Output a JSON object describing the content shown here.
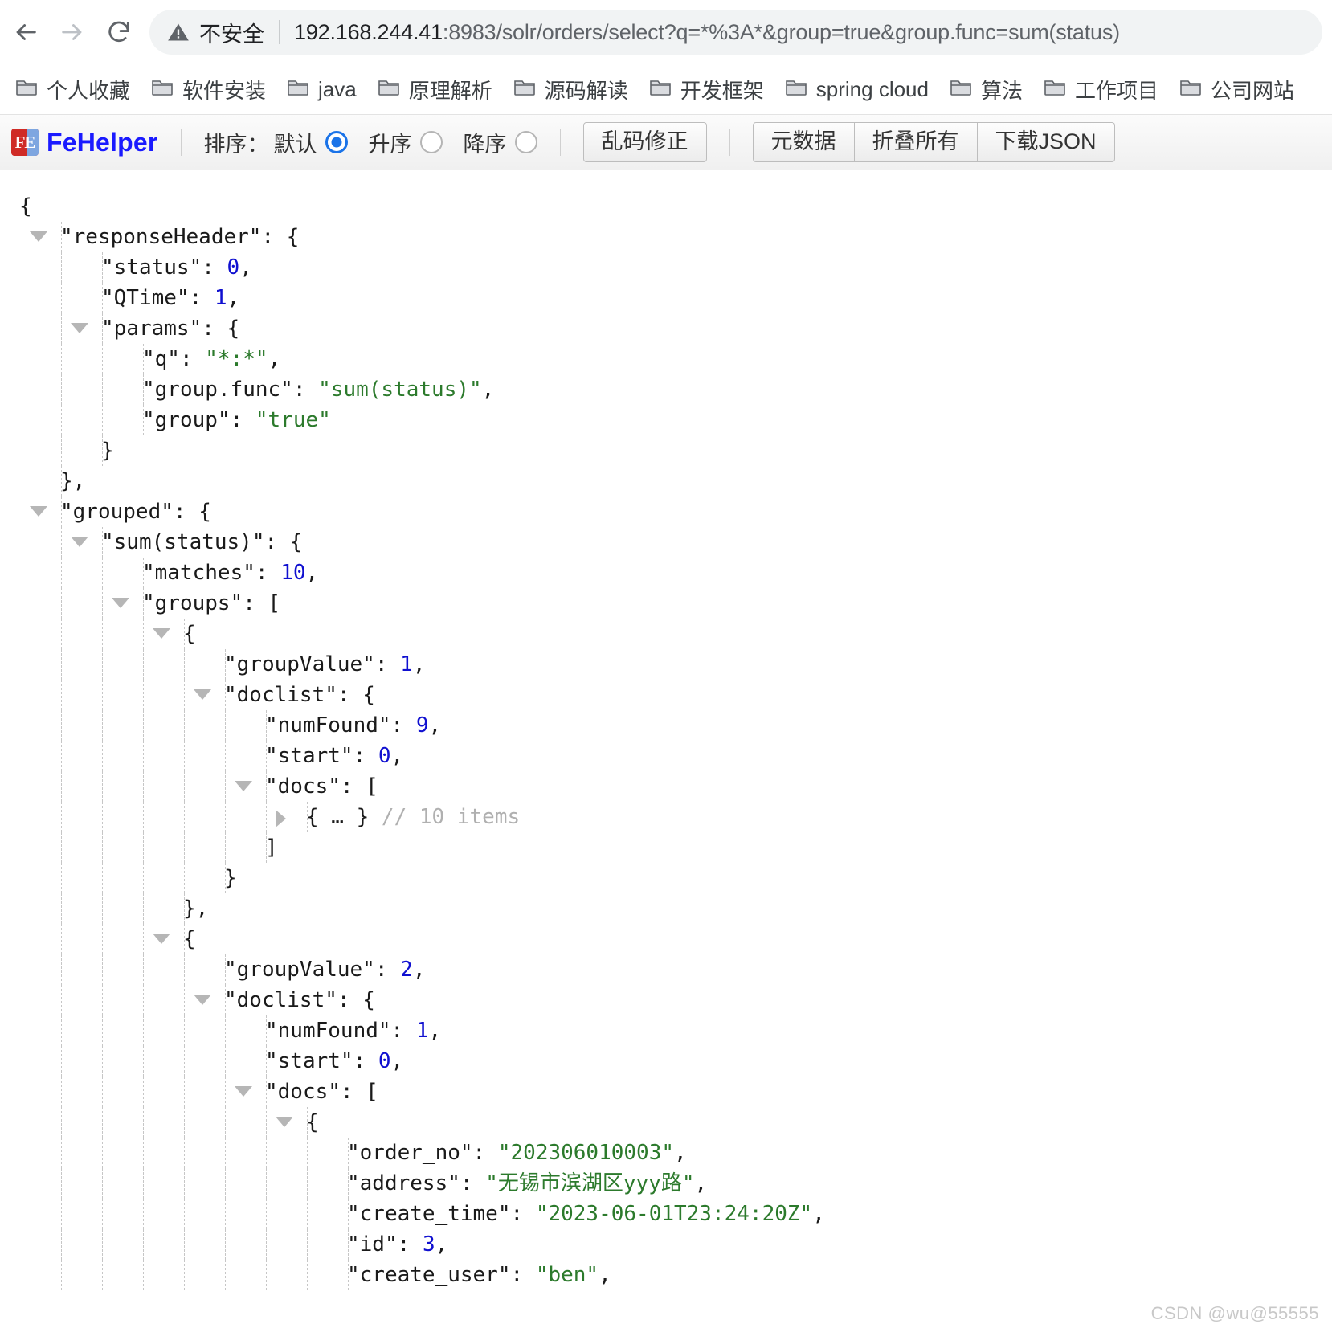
{
  "browser": {
    "back_icon": "arrow-left-icon",
    "forward_icon": "arrow-right-icon",
    "reload_icon": "reload-icon",
    "security_icon": "warning-triangle-icon",
    "security_label": "不安全",
    "url_host": "192.168.244.41",
    "url_rest": ":8983/solr/orders/select?q=*%3A*&group=true&group.func=sum(status)",
    "url_full": "192.168.244.41:8983/solr/orders/select?q=*%3A*&group=true&group.func=sum(status)"
  },
  "bookmarks": {
    "folder_icon": "folder-icon",
    "items": [
      {
        "label": "个人收藏"
      },
      {
        "label": "软件安装"
      },
      {
        "label": "java"
      },
      {
        "label": "原理解析"
      },
      {
        "label": "源码解读"
      },
      {
        "label": "开发框架"
      },
      {
        "label": "spring cloud"
      },
      {
        "label": "算法"
      },
      {
        "label": "工作项目"
      },
      {
        "label": "公司网站"
      }
    ]
  },
  "fehelper": {
    "logo_icon": "fehelper-logo-icon",
    "logo_text": "FE",
    "brand": "FeHelper",
    "sort_label": "排序：",
    "sort_options": [
      {
        "label": "默认",
        "selected": true
      },
      {
        "label": "升序",
        "selected": false
      },
      {
        "label": "降序",
        "selected": false
      }
    ],
    "fix_encoding_label": "乱码修正",
    "metadata_label": "元数据",
    "collapse_all_label": "折叠所有",
    "download_json_label": "下载JSON",
    "accent_color": "#1a73e8",
    "brand_color": "#1a1aff"
  },
  "json_viewer": {
    "colors": {
      "key": "#1a1a1a",
      "string": "#2c7a2c",
      "number": "#1010d0",
      "comment": "#b0b0b0"
    },
    "lines": [
      {
        "indent": 0,
        "guides": 0,
        "toggle": "",
        "tokens": [
          {
            "t": "{",
            "c": "p"
          }
        ]
      },
      {
        "indent": 1,
        "guides": 1,
        "toggle": "open",
        "tokens": [
          {
            "t": "\"responseHeader\"",
            "c": "k"
          },
          {
            "t": ": {",
            "c": "p"
          }
        ]
      },
      {
        "indent": 2,
        "guides": 2,
        "toggle": "",
        "tokens": [
          {
            "t": "\"status\"",
            "c": "k"
          },
          {
            "t": ": ",
            "c": "p"
          },
          {
            "t": "0",
            "c": "n"
          },
          {
            "t": ",",
            "c": "p"
          }
        ]
      },
      {
        "indent": 2,
        "guides": 2,
        "toggle": "",
        "tokens": [
          {
            "t": "\"QTime\"",
            "c": "k"
          },
          {
            "t": ": ",
            "c": "p"
          },
          {
            "t": "1",
            "c": "n"
          },
          {
            "t": ",",
            "c": "p"
          }
        ]
      },
      {
        "indent": 2,
        "guides": 2,
        "toggle": "open",
        "tokens": [
          {
            "t": "\"params\"",
            "c": "k"
          },
          {
            "t": ": {",
            "c": "p"
          }
        ]
      },
      {
        "indent": 3,
        "guides": 3,
        "toggle": "",
        "tokens": [
          {
            "t": "\"q\"",
            "c": "k"
          },
          {
            "t": ": ",
            "c": "p"
          },
          {
            "t": "\"*:*\"",
            "c": "s"
          },
          {
            "t": ",",
            "c": "p"
          }
        ]
      },
      {
        "indent": 3,
        "guides": 3,
        "toggle": "",
        "tokens": [
          {
            "t": "\"group.func\"",
            "c": "k"
          },
          {
            "t": ": ",
            "c": "p"
          },
          {
            "t": "\"sum(status)\"",
            "c": "s"
          },
          {
            "t": ",",
            "c": "p"
          }
        ]
      },
      {
        "indent": 3,
        "guides": 3,
        "toggle": "",
        "tokens": [
          {
            "t": "\"group\"",
            "c": "k"
          },
          {
            "t": ": ",
            "c": "p"
          },
          {
            "t": "\"true\"",
            "c": "s"
          }
        ]
      },
      {
        "indent": 2,
        "guides": 2,
        "toggle": "",
        "tokens": [
          {
            "t": "}",
            "c": "p"
          }
        ]
      },
      {
        "indent": 1,
        "guides": 1,
        "toggle": "",
        "tokens": [
          {
            "t": "},",
            "c": "p"
          }
        ]
      },
      {
        "indent": 1,
        "guides": 1,
        "toggle": "open",
        "tokens": [
          {
            "t": "\"grouped\"",
            "c": "k"
          },
          {
            "t": ": {",
            "c": "p"
          }
        ]
      },
      {
        "indent": 2,
        "guides": 2,
        "toggle": "open",
        "tokens": [
          {
            "t": "\"sum(status)\"",
            "c": "k"
          },
          {
            "t": ": {",
            "c": "p"
          }
        ]
      },
      {
        "indent": 3,
        "guides": 3,
        "toggle": "",
        "tokens": [
          {
            "t": "\"matches\"",
            "c": "k"
          },
          {
            "t": ": ",
            "c": "p"
          },
          {
            "t": "10",
            "c": "n"
          },
          {
            "t": ",",
            "c": "p"
          }
        ]
      },
      {
        "indent": 3,
        "guides": 3,
        "toggle": "open",
        "tokens": [
          {
            "t": "\"groups\"",
            "c": "k"
          },
          {
            "t": ": [",
            "c": "p"
          }
        ]
      },
      {
        "indent": 4,
        "guides": 4,
        "toggle": "open",
        "tokens": [
          {
            "t": "{",
            "c": "p"
          }
        ]
      },
      {
        "indent": 5,
        "guides": 5,
        "toggle": "",
        "tokens": [
          {
            "t": "\"groupValue\"",
            "c": "k"
          },
          {
            "t": ": ",
            "c": "p"
          },
          {
            "t": "1",
            "c": "n"
          },
          {
            "t": ",",
            "c": "p"
          }
        ]
      },
      {
        "indent": 5,
        "guides": 5,
        "toggle": "open",
        "tokens": [
          {
            "t": "\"doclist\"",
            "c": "k"
          },
          {
            "t": ": {",
            "c": "p"
          }
        ]
      },
      {
        "indent": 6,
        "guides": 6,
        "toggle": "",
        "tokens": [
          {
            "t": "\"numFound\"",
            "c": "k"
          },
          {
            "t": ": ",
            "c": "p"
          },
          {
            "t": "9",
            "c": "n"
          },
          {
            "t": ",",
            "c": "p"
          }
        ]
      },
      {
        "indent": 6,
        "guides": 6,
        "toggle": "",
        "tokens": [
          {
            "t": "\"start\"",
            "c": "k"
          },
          {
            "t": ": ",
            "c": "p"
          },
          {
            "t": "0",
            "c": "n"
          },
          {
            "t": ",",
            "c": "p"
          }
        ]
      },
      {
        "indent": 6,
        "guides": 6,
        "toggle": "open",
        "tokens": [
          {
            "t": "\"docs\"",
            "c": "k"
          },
          {
            "t": ": [",
            "c": "p"
          }
        ]
      },
      {
        "indent": 7,
        "guides": 7,
        "toggle": "closed",
        "tokens": [
          {
            "t": "{ … }",
            "c": "p"
          },
          {
            "t": " // 10 items",
            "c": "cmt"
          }
        ]
      },
      {
        "indent": 6,
        "guides": 6,
        "toggle": "",
        "tokens": [
          {
            "t": "]",
            "c": "p"
          }
        ]
      },
      {
        "indent": 5,
        "guides": 5,
        "toggle": "",
        "tokens": [
          {
            "t": "}",
            "c": "p"
          }
        ]
      },
      {
        "indent": 4,
        "guides": 4,
        "toggle": "",
        "tokens": [
          {
            "t": "},",
            "c": "p"
          }
        ]
      },
      {
        "indent": 4,
        "guides": 4,
        "toggle": "open",
        "tokens": [
          {
            "t": "{",
            "c": "p"
          }
        ]
      },
      {
        "indent": 5,
        "guides": 5,
        "toggle": "",
        "tokens": [
          {
            "t": "\"groupValue\"",
            "c": "k"
          },
          {
            "t": ": ",
            "c": "p"
          },
          {
            "t": "2",
            "c": "n"
          },
          {
            "t": ",",
            "c": "p"
          }
        ]
      },
      {
        "indent": 5,
        "guides": 5,
        "toggle": "open",
        "tokens": [
          {
            "t": "\"doclist\"",
            "c": "k"
          },
          {
            "t": ": {",
            "c": "p"
          }
        ]
      },
      {
        "indent": 6,
        "guides": 6,
        "toggle": "",
        "tokens": [
          {
            "t": "\"numFound\"",
            "c": "k"
          },
          {
            "t": ": ",
            "c": "p"
          },
          {
            "t": "1",
            "c": "n"
          },
          {
            "t": ",",
            "c": "p"
          }
        ]
      },
      {
        "indent": 6,
        "guides": 6,
        "toggle": "",
        "tokens": [
          {
            "t": "\"start\"",
            "c": "k"
          },
          {
            "t": ": ",
            "c": "p"
          },
          {
            "t": "0",
            "c": "n"
          },
          {
            "t": ",",
            "c": "p"
          }
        ]
      },
      {
        "indent": 6,
        "guides": 6,
        "toggle": "open",
        "tokens": [
          {
            "t": "\"docs\"",
            "c": "k"
          },
          {
            "t": ": [",
            "c": "p"
          }
        ]
      },
      {
        "indent": 7,
        "guides": 7,
        "toggle": "open",
        "tokens": [
          {
            "t": "{",
            "c": "p"
          }
        ]
      },
      {
        "indent": 8,
        "guides": 8,
        "toggle": "",
        "tokens": [
          {
            "t": "\"order_no\"",
            "c": "k"
          },
          {
            "t": ": ",
            "c": "p"
          },
          {
            "t": "\"202306010003\"",
            "c": "s"
          },
          {
            "t": ",",
            "c": "p"
          }
        ]
      },
      {
        "indent": 8,
        "guides": 8,
        "toggle": "",
        "tokens": [
          {
            "t": "\"address\"",
            "c": "k"
          },
          {
            "t": ": ",
            "c": "p"
          },
          {
            "t": "\"无锡市滨湖区yyy路\"",
            "c": "s"
          },
          {
            "t": ",",
            "c": "p"
          }
        ]
      },
      {
        "indent": 8,
        "guides": 8,
        "toggle": "",
        "tokens": [
          {
            "t": "\"create_time\"",
            "c": "k"
          },
          {
            "t": ": ",
            "c": "p"
          },
          {
            "t": "\"2023-06-01T23:24:20Z\"",
            "c": "s"
          },
          {
            "t": ",",
            "c": "p"
          }
        ]
      },
      {
        "indent": 8,
        "guides": 8,
        "toggle": "",
        "tokens": [
          {
            "t": "\"id\"",
            "c": "k"
          },
          {
            "t": ": ",
            "c": "p"
          },
          {
            "t": "3",
            "c": "n"
          },
          {
            "t": ",",
            "c": "p"
          }
        ]
      },
      {
        "indent": 8,
        "guides": 8,
        "toggle": "",
        "tokens": [
          {
            "t": "\"create_user\"",
            "c": "k"
          },
          {
            "t": ": ",
            "c": "p"
          },
          {
            "t": "\"ben\"",
            "c": "s"
          },
          {
            "t": ",",
            "c": "p"
          }
        ]
      }
    ]
  },
  "watermark": "CSDN @wu@55555"
}
